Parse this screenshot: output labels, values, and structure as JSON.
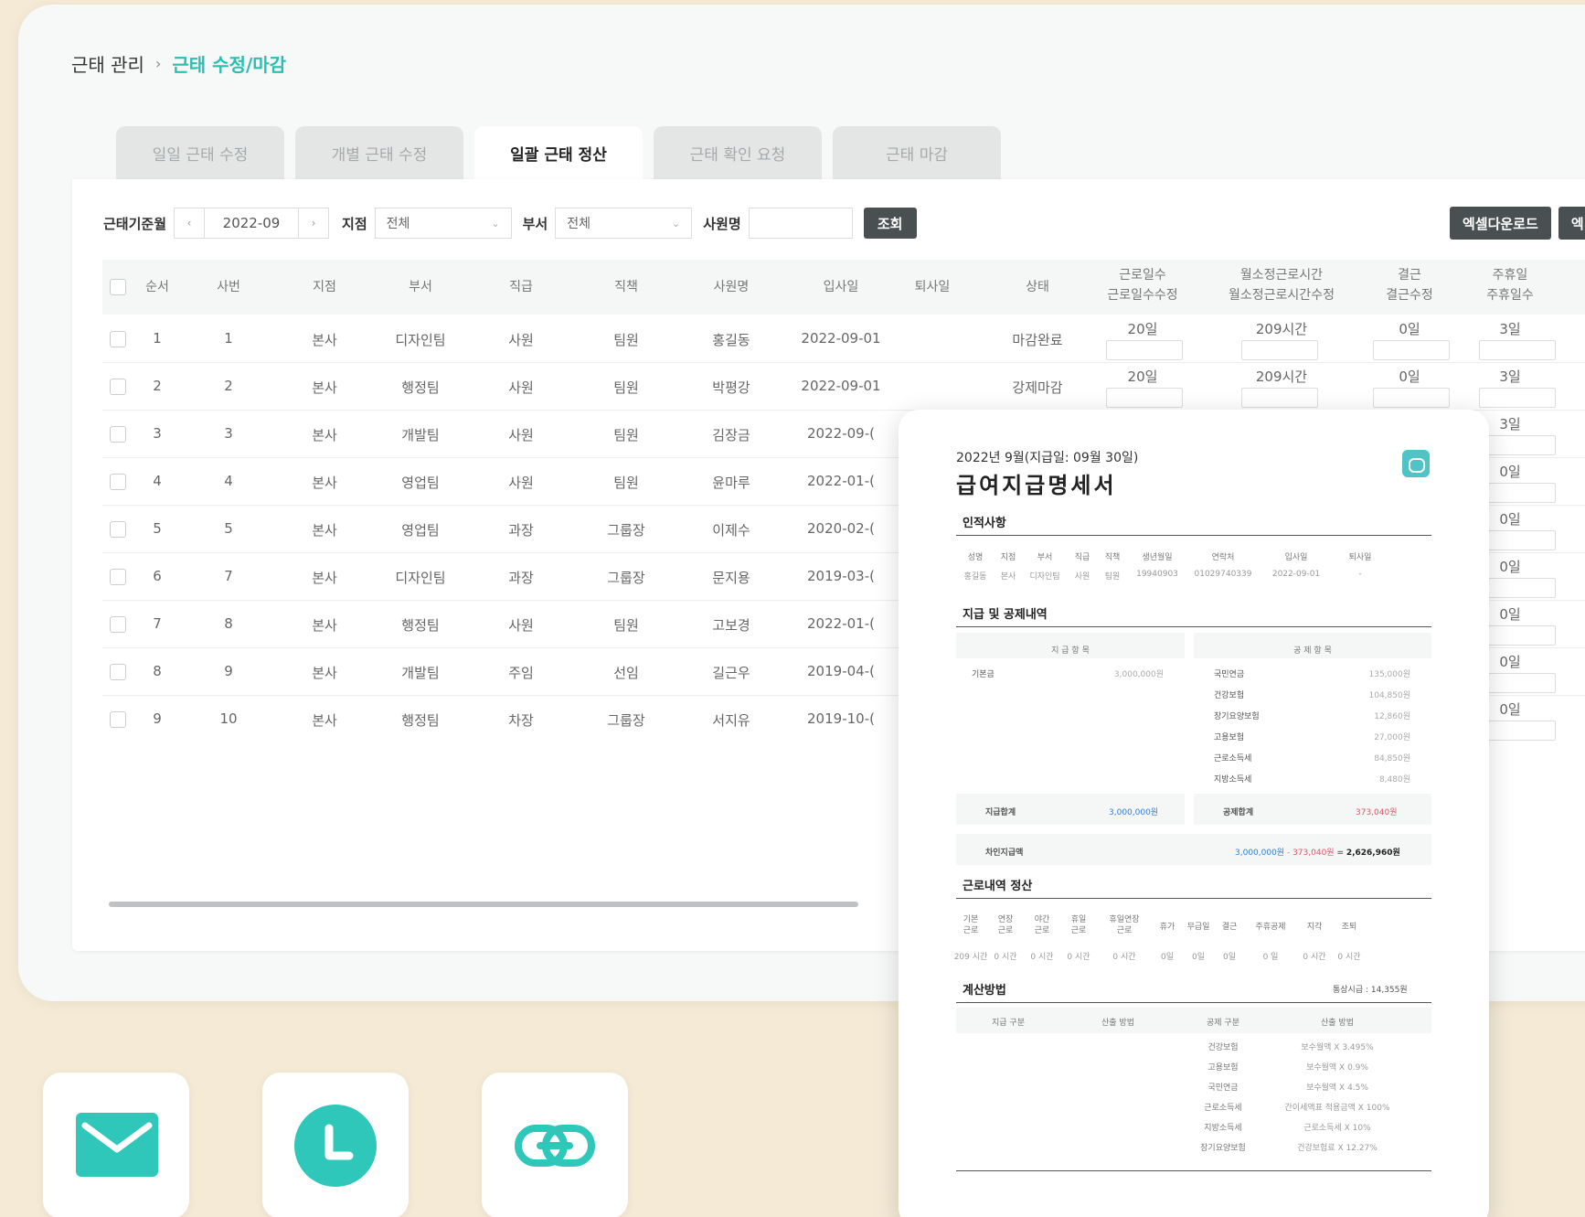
{
  "breadcrumb": {
    "root": "근태 관리",
    "separator": "›",
    "current": "근태 수정/마감"
  },
  "tabs": [
    {
      "label": "일일 근태 수정",
      "active": false
    },
    {
      "label": "개별 근태 수정",
      "active": false
    },
    {
      "label": "일괄 근태 정산",
      "active": true
    },
    {
      "label": "근태 확인 요청",
      "active": false
    },
    {
      "label": "근태 마감",
      "active": false
    }
  ],
  "filter": {
    "month_label": "근태기준월",
    "prev": "‹",
    "month_value": "2022-09",
    "next": "›",
    "branch_label": "지점",
    "branch_value": "전체",
    "dept_label": "부서",
    "dept_value": "전체",
    "name_label": "사원명",
    "name_value": "",
    "search_label": "조회"
  },
  "actions": {
    "excel_download": "엑셀다운로드",
    "excel_upload": "엑"
  },
  "table": {
    "headers": {
      "no": "순서",
      "emp_no": "사번",
      "branch": "지점",
      "dept": "부서",
      "grade": "직급",
      "position": "직책",
      "name": "사원명",
      "join": "입사일",
      "leave": "퇴사일",
      "status": "상태",
      "workdays": "근로일수",
      "workdays_edit": "근로일수수정",
      "hours": "월소정근로시간",
      "hours_edit": "월소정근로시간수정",
      "absent": "결근",
      "absent_edit": "결근수정",
      "holiday": "주휴일",
      "holiday_edit": "주휴일수"
    },
    "rows": [
      {
        "no": "1",
        "emp_no": "1",
        "branch": "본사",
        "dept": "디자인팀",
        "grade": "사원",
        "position": "팀원",
        "name": "홍길동",
        "join": "2022-09-01",
        "status": "마감완료",
        "workdays": "20일",
        "hours": "209시간",
        "absent": "0일",
        "holiday": "3일"
      },
      {
        "no": "2",
        "emp_no": "2",
        "branch": "본사",
        "dept": "행정팀",
        "grade": "사원",
        "position": "팀원",
        "name": "박평강",
        "join": "2022-09-01",
        "status": "강제마감",
        "workdays": "20일",
        "hours": "209시간",
        "absent": "0일",
        "holiday": "3일"
      },
      {
        "no": "3",
        "emp_no": "3",
        "branch": "본사",
        "dept": "개발팀",
        "grade": "사원",
        "position": "팀원",
        "name": "김장금",
        "join": "2022-09-(",
        "holiday": "3일"
      },
      {
        "no": "4",
        "emp_no": "4",
        "branch": "본사",
        "dept": "영업팀",
        "grade": "사원",
        "position": "팀원",
        "name": "윤마루",
        "join": "2022-01-(",
        "holiday": "0일"
      },
      {
        "no": "5",
        "emp_no": "5",
        "branch": "본사",
        "dept": "영업팀",
        "grade": "과장",
        "position": "그룹장",
        "name": "이제수",
        "join": "2020-02-(",
        "holiday": "0일"
      },
      {
        "no": "6",
        "emp_no": "7",
        "branch": "본사",
        "dept": "디자인팀",
        "grade": "과장",
        "position": "그룹장",
        "name": "문지용",
        "join": "2019-03-(",
        "holiday": "0일"
      },
      {
        "no": "7",
        "emp_no": "8",
        "branch": "본사",
        "dept": "행정팀",
        "grade": "사원",
        "position": "팀원",
        "name": "고보경",
        "join": "2022-01-(",
        "holiday": "0일"
      },
      {
        "no": "8",
        "emp_no": "9",
        "branch": "본사",
        "dept": "개발팀",
        "grade": "주임",
        "position": "선임",
        "name": "길근우",
        "join": "2019-04-(",
        "holiday": "0일"
      },
      {
        "no": "9",
        "emp_no": "10",
        "branch": "본사",
        "dept": "행정팀",
        "grade": "차장",
        "position": "그룹장",
        "name": "서지유",
        "join": "2019-10-(",
        "holiday": "0일"
      }
    ]
  },
  "payslip": {
    "date": "2022년 9월(지급일: 09월 30일)",
    "title": "급여지급명세서",
    "personal": {
      "title": "인적사항",
      "headers": [
        "성명",
        "지점",
        "부서",
        "직급",
        "직책",
        "생년월일",
        "연락처",
        "입사일",
        "퇴사일"
      ],
      "values": [
        "홍길동",
        "본사",
        "디자인팀",
        "사원",
        "팀원",
        "19940903",
        "01029740339",
        "2022-09-01",
        "-"
      ]
    },
    "pay": {
      "title": "지급 및 공제내역",
      "earn_header": "지 급 항 목",
      "deduct_header": "공 제 항 목",
      "earn_items": [
        {
          "label": "기본금",
          "amount": "3,000,000원"
        }
      ],
      "deduct_items": [
        {
          "label": "국민연금",
          "amount": "135,000원"
        },
        {
          "label": "건강보험",
          "amount": "104,850원"
        },
        {
          "label": "장기요양보험",
          "amount": "12,860원"
        },
        {
          "label": "고용보험",
          "amount": "27,000원"
        },
        {
          "label": "근로소득세",
          "amount": "84,850원"
        },
        {
          "label": "지방소득세",
          "amount": "8,480원"
        }
      ],
      "earn_total_label": "지급합계",
      "earn_total": "3,000,000원",
      "deduct_total_label": "공제합계",
      "deduct_total": "373,040원",
      "net_label": "차인지급액",
      "net_a": "3,000,000원",
      "net_minus": " - ",
      "net_b": "373,040원",
      "net_eq": " = ",
      "net_result": "2,626,960원"
    },
    "work": {
      "title": "근로내역 정산",
      "headers": [
        "기본\n근로",
        "연장\n근로",
        "야간\n근로",
        "휴일\n근로",
        "휴일연장\n근로",
        "휴가",
        "무급일",
        "결근",
        "주휴공제",
        "지각",
        "조퇴"
      ],
      "values": [
        "209 시간",
        "0 시간",
        "0 시간",
        "0 시간",
        "0 시간",
        "0일",
        "0일",
        "0일",
        "0 일",
        "0 시간",
        "0 시간"
      ]
    },
    "calc": {
      "title": "계산방법",
      "wage": "통상시급 : 14,355원",
      "h1": "지급 구분",
      "h2": "산출 방법",
      "h3": "공제 구분",
      "h4": "산출 방법",
      "items": [
        {
          "label": "건강보험",
          "method": "보수월액 X 3.495%"
        },
        {
          "label": "고용보험",
          "method": "보수월액 X 0.9%"
        },
        {
          "label": "국민연금",
          "method": "보수월액 X 4.5%"
        },
        {
          "label": "근로소득세",
          "method": "간이세액표 적용금액 X 100%"
        },
        {
          "label": "지방소득세",
          "method": "근로소득세 X 10%"
        },
        {
          "label": "장기요양보험",
          "method": "건강보험료 X 12.27%"
        }
      ]
    }
  },
  "shortcuts": [
    {
      "icon": "mail-icon"
    },
    {
      "icon": "clock-icon"
    },
    {
      "icon": "link-icon"
    }
  ],
  "colors": {
    "accent": "#2bbfb2",
    "dark_button": "#4a4f52",
    "page_bg": "#f4ead6",
    "net_blue": "#2f7fd6",
    "net_red": "#e0556b"
  }
}
